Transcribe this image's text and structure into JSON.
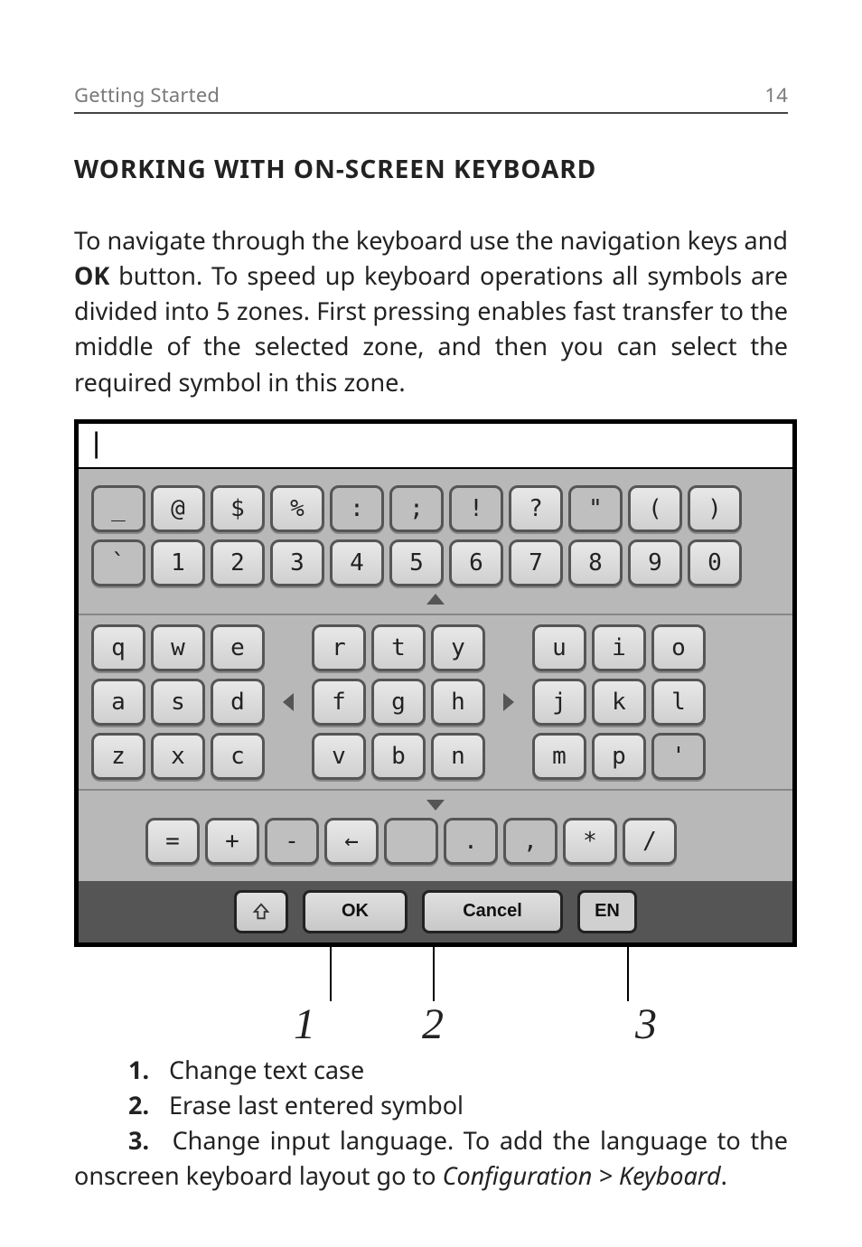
{
  "header": {
    "section": "Getting Started",
    "page_number": "14"
  },
  "heading": "WORKING WITH ON-SCREEN KEYBOARD",
  "intro": {
    "part1": "To navigate through the keyboard use the navigation keys and ",
    "ok": "OK",
    "part2": " button. To speed up keyboard operations all symbols are divided into 5 zones. First pressing enables fast transfer to the middle of the selected zone, and then you can select the required symbol in this zone."
  },
  "keyboard": {
    "input_value": "|",
    "row_sym": [
      "_",
      "@",
      "$",
      "%",
      ":",
      ";",
      "!",
      "?",
      "\"",
      "(",
      ")"
    ],
    "row_num": [
      "`",
      "1",
      "2",
      "3",
      "4",
      "5",
      "6",
      "7",
      "8",
      "9",
      "0"
    ],
    "mid": {
      "left": [
        [
          "q",
          "w",
          "e"
        ],
        [
          "a",
          "s",
          "d"
        ],
        [
          "z",
          "x",
          "c"
        ]
      ],
      "center": [
        [
          "r",
          "t",
          "y"
        ],
        [
          "f",
          "g",
          "h"
        ],
        [
          "v",
          "b",
          "n"
        ]
      ],
      "right": [
        [
          "u",
          "i",
          "o"
        ],
        [
          "j",
          "k",
          "l"
        ],
        [
          "m",
          "p",
          "'"
        ]
      ]
    },
    "row_op": [
      "=",
      "+",
      "-",
      "←",
      " ",
      ".",
      ",",
      "*",
      "/"
    ],
    "actions": {
      "shift": "⇧",
      "ok": "OK",
      "cancel": "Cancel",
      "lang": "EN"
    }
  },
  "callouts": {
    "n1": "1",
    "n2": "2",
    "n3": "3",
    "items": [
      {
        "n": "1.",
        "text": "Change text case"
      },
      {
        "n": "2.",
        "text": "Erase last entered symbol"
      },
      {
        "n": "3.",
        "text_a": "Change input language. To add the language to the onscreen keyboard layout go to ",
        "path": "Configuration > Keyboard",
        "text_b": "."
      }
    ]
  }
}
